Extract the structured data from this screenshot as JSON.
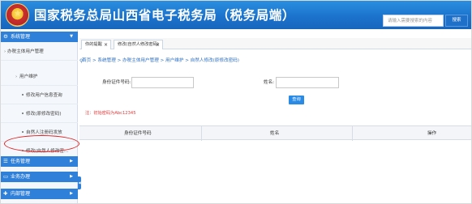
{
  "header": {
    "title": "国家税务总局山西省电子税务局（税务局端）",
    "search_placeholder": "请输入需要搜索的内容",
    "search_button": "搜索"
  },
  "sidebar": {
    "groups": [
      {
        "label": "系统管理",
        "icon": "gear-icon"
      },
      {
        "label": "任务管理",
        "icon": "task-icon"
      },
      {
        "label": "业务办理",
        "icon": "monitor-icon"
      },
      {
        "label": "内部管理",
        "icon": "tools-icon"
      }
    ],
    "items": [
      {
        "label": "办税主体用户管理",
        "level": 1
      },
      {
        "label": "用户维护",
        "level": 2
      },
      {
        "label": "修改用户信息查询",
        "level": 3
      },
      {
        "label": "修改(原修改密码)",
        "level": 3
      },
      {
        "label": "自然人注册码发放",
        "level": 3
      },
      {
        "label": "修改(自然人修改密...",
        "level": 3
      }
    ]
  },
  "tabs": [
    {
      "label": "你的提醒"
    },
    {
      "label": "修改(自然人修改密码)"
    }
  ],
  "breadcrumb": "首页 > 系统管理 > 办税主体用户管理 > 用户维护 > 自然人修改(原修改密码)",
  "form": {
    "id_label": "身份证件号码:",
    "name_label": "姓名:",
    "query_button": "查询",
    "note": "注：初始密码为Abc12345"
  },
  "table": {
    "columns": [
      "身份证件号码",
      "姓名",
      "操作"
    ]
  },
  "colors": {
    "header_blue": "#1c73cc",
    "sidebar_group_blue": "#2f80d8",
    "link_blue": "#2b6fc2",
    "note_red": "#e03a3a",
    "highlight_red": "#e02020"
  }
}
